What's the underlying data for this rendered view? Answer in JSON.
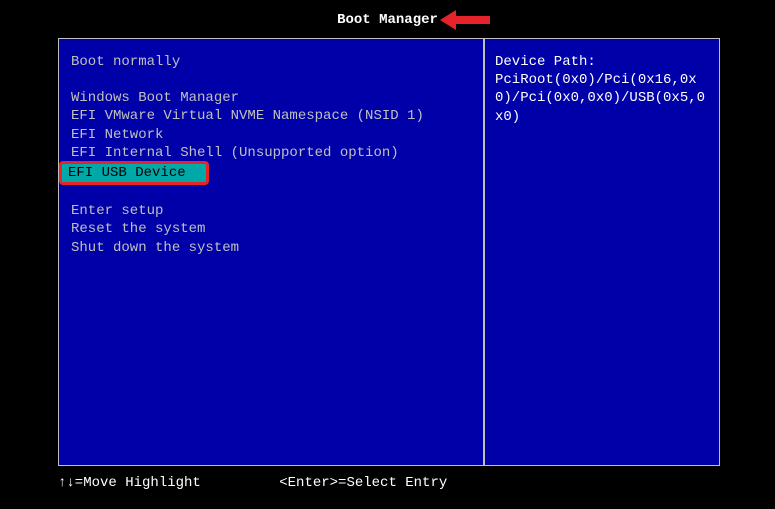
{
  "header": {
    "title": "Boot Manager"
  },
  "menu": {
    "boot_normally": "Boot normally",
    "windows_boot": "Windows Boot Manager",
    "efi_nvme": "EFI VMware Virtual NVME Namespace (NSID 1)",
    "efi_network": "EFI Network",
    "efi_shell": "EFI Internal Shell (Unsupported option)",
    "efi_usb": "EFI USB Device",
    "enter_setup": "Enter setup",
    "reset": "Reset the system",
    "shutdown": "Shut down the system"
  },
  "side": {
    "label": "Device Path:",
    "value": "PciRoot(0x0)/Pci(0x16,0x0)/Pci(0x0,0x0)/USB(0x5,0x0)"
  },
  "help": {
    "move": "↑↓=Move Highlight",
    "select": "<Enter>=Select Entry"
  },
  "annotation": {
    "arrow_color": "#e5232b"
  }
}
